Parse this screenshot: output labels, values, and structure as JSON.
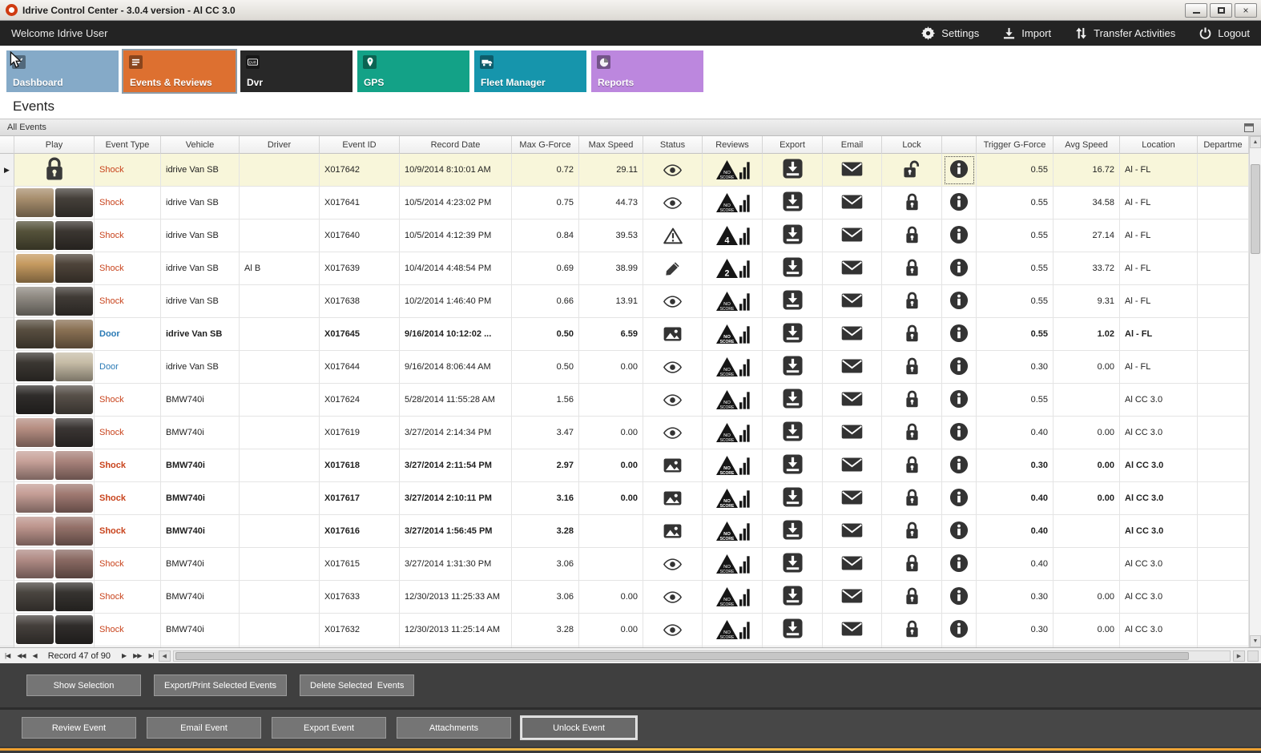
{
  "window": {
    "title": "Idrive Control Center - 3.0.4 version - Al CC 3.0"
  },
  "topbar": {
    "welcome": "Welcome Idrive User",
    "actions": [
      {
        "label": "Settings",
        "icon": "gear"
      },
      {
        "label": "Import",
        "icon": "import"
      },
      {
        "label": "Transfer Activities",
        "icon": "transfer"
      },
      {
        "label": "Logout",
        "icon": "power"
      }
    ]
  },
  "nav": {
    "tiles": [
      {
        "label": "Dashboard",
        "icon": "dashboard",
        "color": "#85aac8",
        "active": false
      },
      {
        "label": "Events & Reviews",
        "icon": "events",
        "color": "#dd7030",
        "active": true
      },
      {
        "label": "Dvr",
        "icon": "dvr",
        "color": "#282828",
        "active": false
      },
      {
        "label": "GPS",
        "icon": "gps",
        "color": "#13a287",
        "active": false
      },
      {
        "label": "Fleet Manager",
        "icon": "fleet",
        "color": "#1695ac",
        "active": false
      },
      {
        "label": "Reports",
        "icon": "reports",
        "color": "#bc87de",
        "active": false
      }
    ]
  },
  "page": {
    "title": "Events",
    "group": "All Events"
  },
  "table": {
    "columns": [
      "",
      "Play",
      "Event Type",
      "Vehicle",
      "Driver",
      "Event ID",
      "Record Date",
      "Max G-Force",
      "Max Speed",
      "Status",
      "Reviews",
      "Export",
      "Email",
      "Lock",
      "",
      "Trigger G-Force",
      "Avg Speed",
      "Location",
      "Departme"
    ],
    "rows": [
      {
        "selected": true,
        "bold": false,
        "play": "lock",
        "thumb": [],
        "type": "Shock",
        "type_color": "shock",
        "vehicle": "idrive Van SB",
        "driver": "",
        "id": "X017642",
        "date": "10/9/2014 8:10:01 AM",
        "max_g": "0.72",
        "max_speed": "29.11",
        "status": "eye",
        "review": "noscore",
        "lock": "unlocked",
        "trigger_g": "0.55",
        "avg_speed": "16.72",
        "location": "Al - FL"
      },
      {
        "selected": false,
        "bold": false,
        "play": "thumb",
        "thumb": [
          "#a88f6e",
          "#45403a"
        ],
        "type": "Shock",
        "type_color": "shock",
        "vehicle": "idrive Van SB",
        "driver": "",
        "id": "X017641",
        "date": "10/5/2014 4:23:02 PM",
        "max_g": "0.75",
        "max_speed": "44.73",
        "status": "eye",
        "review": "noscore",
        "lock": "locked",
        "trigger_g": "0.55",
        "avg_speed": "34.58",
        "location": "Al - FL"
      },
      {
        "selected": false,
        "bold": false,
        "play": "thumb",
        "thumb": [
          "#55523a",
          "#3b3631"
        ],
        "type": "Shock",
        "type_color": "shock",
        "vehicle": "idrive Van SB",
        "driver": "",
        "id": "X017640",
        "date": "10/5/2014 4:12:39 PM",
        "max_g": "0.84",
        "max_speed": "39.53",
        "status": "warning",
        "review": "4",
        "lock": "locked",
        "trigger_g": "0.55",
        "avg_speed": "27.14",
        "location": "Al - FL"
      },
      {
        "selected": false,
        "bold": false,
        "play": "thumb",
        "thumb": [
          "#c59a60",
          "#4e443a"
        ],
        "type": "Shock",
        "type_color": "shock",
        "vehicle": "idrive Van SB",
        "driver": "Al B",
        "id": "X017639",
        "date": "10/4/2014 4:48:54 PM",
        "max_g": "0.69",
        "max_speed": "38.99",
        "status": "pencil",
        "review": "2",
        "lock": "locked",
        "trigger_g": "0.55",
        "avg_speed": "33.72",
        "location": "Al - FL"
      },
      {
        "selected": false,
        "bold": false,
        "play": "thumb",
        "thumb": [
          "#8f8a82",
          "#403b36"
        ],
        "type": "Shock",
        "type_color": "shock",
        "vehicle": "idrive Van SB",
        "driver": "",
        "id": "X017638",
        "date": "10/2/2014 1:46:40 PM",
        "max_g": "0.66",
        "max_speed": "13.91",
        "status": "eye",
        "review": "noscore",
        "lock": "locked",
        "trigger_g": "0.55",
        "avg_speed": "9.31",
        "location": "Al - FL"
      },
      {
        "selected": false,
        "bold": true,
        "play": "thumb",
        "thumb": [
          "#584e40",
          "#8a7154"
        ],
        "type": "Door",
        "type_color": "door",
        "vehicle": "idrive Van SB",
        "driver": "",
        "id": "X017645",
        "date": "9/16/2014 10:12:02 ...",
        "max_g": "0.50",
        "max_speed": "6.59",
        "status": "image",
        "review": "noscore",
        "lock": "locked",
        "trigger_g": "0.55",
        "avg_speed": "1.02",
        "location": "Al - FL"
      },
      {
        "selected": false,
        "bold": false,
        "play": "thumb",
        "thumb": [
          "#3b3732",
          "#c6bca6"
        ],
        "type": "Door",
        "type_color": "door",
        "vehicle": "idrive Van SB",
        "driver": "",
        "id": "X017644",
        "date": "9/16/2014 8:06:44 AM",
        "max_g": "0.50",
        "max_speed": "0.00",
        "status": "eye",
        "review": "noscore",
        "lock": "locked",
        "trigger_g": "0.30",
        "avg_speed": "0.00",
        "location": "Al - FL"
      },
      {
        "selected": false,
        "bold": false,
        "play": "thumb",
        "thumb": [
          "#2f2c2a",
          "#575049"
        ],
        "type": "Shock",
        "type_color": "shock",
        "vehicle": "BMW740i",
        "driver": "",
        "id": "X017624",
        "date": "5/28/2014 11:55:28 AM",
        "max_g": "1.56",
        "max_speed": "",
        "status": "eye",
        "review": "noscore",
        "lock": "locked",
        "trigger_g": "0.55",
        "avg_speed": "",
        "location": "Al CC 3.0"
      },
      {
        "selected": false,
        "bold": false,
        "play": "thumb",
        "thumb": [
          "#b68e82",
          "#3a3533"
        ],
        "type": "Shock",
        "type_color": "shock",
        "vehicle": "BMW740i",
        "driver": "",
        "id": "X017619",
        "date": "3/27/2014 2:14:34 PM",
        "max_g": "3.47",
        "max_speed": "0.00",
        "status": "eye",
        "review": "noscore",
        "lock": "locked",
        "trigger_g": "0.40",
        "avg_speed": "0.00",
        "location": "Al CC 3.0"
      },
      {
        "selected": false,
        "bold": true,
        "play": "thumb",
        "thumb": [
          "#c7a199",
          "#a9837b"
        ],
        "type": "Shock",
        "type_color": "shock",
        "vehicle": "BMW740i",
        "driver": "",
        "id": "X017618",
        "date": "3/27/2014 2:11:54 PM",
        "max_g": "2.97",
        "max_speed": "0.00",
        "status": "image",
        "review": "noscore",
        "lock": "locked",
        "trigger_g": "0.30",
        "avg_speed": "0.00",
        "location": "Al CC 3.0"
      },
      {
        "selected": false,
        "bold": true,
        "play": "thumb",
        "thumb": [
          "#c59e96",
          "#a07a72"
        ],
        "type": "Shock",
        "type_color": "shock",
        "vehicle": "BMW740i",
        "driver": "",
        "id": "X017617",
        "date": "3/27/2014 2:10:11 PM",
        "max_g": "3.16",
        "max_speed": "0.00",
        "status": "image",
        "review": "noscore",
        "lock": "locked",
        "trigger_g": "0.40",
        "avg_speed": "0.00",
        "location": "Al CC 3.0"
      },
      {
        "selected": false,
        "bold": true,
        "play": "thumb",
        "thumb": [
          "#bd958d",
          "#95726a"
        ],
        "type": "Shock",
        "type_color": "shock",
        "vehicle": "BMW740i",
        "driver": "",
        "id": "X017616",
        "date": "3/27/2014 1:56:45 PM",
        "max_g": "3.28",
        "max_speed": "",
        "status": "image",
        "review": "noscore",
        "lock": "locked",
        "trigger_g": "0.40",
        "avg_speed": "",
        "location": "Al CC 3.0"
      },
      {
        "selected": false,
        "bold": false,
        "play": "thumb",
        "thumb": [
          "#b08b85",
          "#8a6a63"
        ],
        "type": "Shock",
        "type_color": "shock",
        "vehicle": "BMW740i",
        "driver": "",
        "id": "X017615",
        "date": "3/27/2014 1:31:30 PM",
        "max_g": "3.06",
        "max_speed": "",
        "status": "eye",
        "review": "noscore",
        "lock": "locked",
        "trigger_g": "0.40",
        "avg_speed": "",
        "location": "Al CC 3.0"
      },
      {
        "selected": false,
        "bold": false,
        "play": "thumb",
        "thumb": [
          "#4a4540",
          "#363330"
        ],
        "type": "Shock",
        "type_color": "shock",
        "vehicle": "BMW740i",
        "driver": "",
        "id": "X017633",
        "date": "12/30/2013 11:25:33 AM",
        "max_g": "3.06",
        "max_speed": "0.00",
        "status": "eye",
        "review": "noscore",
        "lock": "locked",
        "trigger_g": "0.30",
        "avg_speed": "0.00",
        "location": "Al CC 3.0"
      },
      {
        "selected": false,
        "bold": false,
        "play": "thumb",
        "thumb": [
          "#45403c",
          "#302d2b"
        ],
        "type": "Shock",
        "type_color": "shock",
        "vehicle": "BMW740i",
        "driver": "",
        "id": "X017632",
        "date": "12/30/2013 11:25:14 AM",
        "max_g": "3.28",
        "max_speed": "0.00",
        "status": "eye",
        "review": "noscore",
        "lock": "locked",
        "trigger_g": "0.30",
        "avg_speed": "0.00",
        "location": "Al CC 3.0"
      },
      {
        "selected": false,
        "bold": false,
        "play": "thumb",
        "thumb": [
          "#3a3734",
          "#2b2927"
        ],
        "type": "",
        "type_color": "shock",
        "vehicle": "",
        "driver": "",
        "id": "",
        "date": "",
        "max_g": "",
        "max_speed": "",
        "status": "",
        "review": "",
        "lock": "locked",
        "trigger_g": "",
        "avg_speed": "",
        "location": ""
      }
    ]
  },
  "navigator": {
    "record_label": "Record 47 of 90"
  },
  "selection_panel": {
    "buttons": [
      "Show Selection",
      "Export/Print Selected Events",
      "Delete Selected  Events"
    ]
  },
  "action_panel": {
    "buttons": [
      {
        "label": "Review Event",
        "focused": false
      },
      {
        "label": "Email Event",
        "focused": false
      },
      {
        "label": "Export Event",
        "focused": false
      },
      {
        "label": "Attachments",
        "focused": false
      },
      {
        "label": "Unlock Event",
        "focused": true
      }
    ]
  },
  "colors": {
    "accent_orange": "#dd7030",
    "selected_row": "#f8f6da",
    "shock_text": "#c8431c",
    "door_text": "#2a7ab5",
    "bottom_line": "#f2a93b"
  }
}
